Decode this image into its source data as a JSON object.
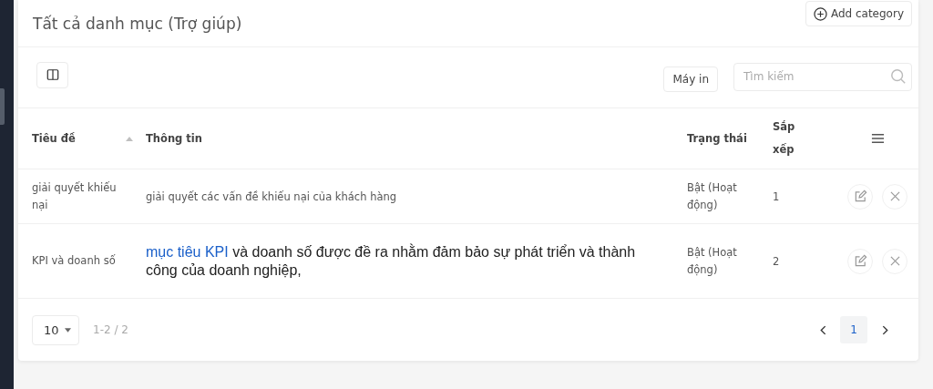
{
  "header": {
    "title": "Tất cả danh mục (Trợ giúp)",
    "add_button": "Add category"
  },
  "toolbar": {
    "print_button": "Máy in",
    "search": {
      "placeholder": "Tìm kiếm"
    }
  },
  "table": {
    "columns": [
      "Tiêu đề",
      "Thông tin",
      "Trạng thái",
      "Sắp xếp"
    ],
    "rows": [
      {
        "kind": "plain",
        "title": "giải quyết khiếu nại",
        "info": "giải quyết các vấn đề khiếu nại của khách hàng",
        "status": "Bật (Hoạt động)",
        "order": "1"
      },
      {
        "kind": "formatted",
        "title": "KPI và doanh số",
        "info_link": "mục tiêu KPI",
        "info": " và doanh số được đề ra nhằm đảm bảo sự phát triển và thành công của doanh nghiệp,",
        "status": "Bật (Hoạt động)",
        "order": "2"
      }
    ]
  },
  "footer": {
    "page_size": "10",
    "range": "1-2 / 2",
    "pages": [
      {
        "label": "1",
        "selected": true
      }
    ]
  }
}
